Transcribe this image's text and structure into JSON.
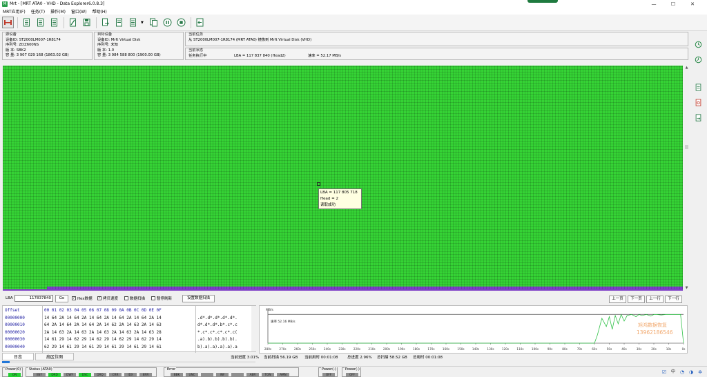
{
  "window": {
    "title": "Mrt - [MRT ATA0 - VHD - Data Explorer6.0.8.3]",
    "app_icon": "mrt-app-icon",
    "controls": {
      "minimize": "—",
      "maximize": "☐",
      "close": "✕"
    }
  },
  "menu": [
    "MRT应用(F)",
    "任务(T)",
    "操作(M)",
    "窗口(W)",
    "帮助(H)"
  ],
  "toolbar": {
    "items": [
      "disk-io-icon",
      "document-icon",
      "document-icon",
      "document-icon",
      "edit-doc-icon",
      "save-icon",
      "document-flow-icon",
      "document-search-icon",
      "list-doc-icon",
      "dropdown-icon",
      "copy-icon",
      "pause-icon",
      "stop-icon",
      "exit-icon"
    ]
  },
  "source_device": {
    "header": "源设备",
    "device_id": "设备ID: ST2000LM007-1R8174",
    "serial": "序列号: ZDZ600NS",
    "version": "版    本: SBK2",
    "capacity": "容    量: 3 907 029 168 (1863.02 GB)"
  },
  "target_device": {
    "header": "目标设备",
    "device_id": "设备ID: Mrft Virtual Disk",
    "serial": "序列号: 未知",
    "version": "版    本: 1.0",
    "capacity": "容    量: 3 984 588 800 (1900.00 GB)"
  },
  "task": {
    "header": "当前任务",
    "description": "从 ST2000LM007-1R8174 (MRT ATA0) 镜像到 Mrft Virtual Disk (VHD)",
    "status_header": "当前状态",
    "status": "任务执行中",
    "lba_status": "LBA = 117 837 840 (Head2)",
    "speed": "速率 = 52.17 MB/s"
  },
  "tooltip": {
    "lba": "LBA = 117 805 718",
    "head": "Head = 2",
    "result": "读取成功"
  },
  "lba_bar": {
    "label": "LBA",
    "value": "117837840",
    "go": "Go",
    "hex_check": "Hex数据",
    "hex_checked": true,
    "copy_speed_check": "拷贝速度",
    "copy_speed_checked": true,
    "scan_check": "数据扫描",
    "scan_checked": false,
    "refresh_check": "暂停刷新",
    "refresh_checked": false,
    "set_scan": "设置数据扫描",
    "prev_page": "上一页",
    "next_page": "下一页",
    "prev_row": "上一行",
    "next_row": "下一行"
  },
  "hex": {
    "header_offset": "Offset",
    "header_bytes": "00 01 02 03 04 05 06 07 08 09 0A 0B 0C 0D 0E 0F",
    "rows": [
      {
        "offset": "00000000",
        "bytes": "14 64 2A 14 64 2A 14 64 2A 14 64 2A 14 64 2A 14",
        "ascii": ".d*.d*.d*.d*.d*."
      },
      {
        "offset": "00000010",
        "bytes": "64 2A 14 64 2A 14 64 2A 14 62 2A 14 63 2A 14 63",
        "ascii": "d*.d*.d*.b*.c*.c"
      },
      {
        "offset": "00000020",
        "bytes": "2A 14 63 2A 14 63 2A 14 63 2A 14 63 2A 14 63 28",
        "ascii": "*.c*.c*.c*.c*.c("
      },
      {
        "offset": "00000030",
        "bytes": "14 61 29 14 62 29 14 62 29 14 62 29 14 62 29 14",
        "ascii": ".a).b).b).b).b)."
      },
      {
        "offset": "00000040",
        "bytes": "62 29 14 61 29 14 61 29 14 61 29 14 61 29 14 61",
        "ascii": "b).a).a).a).a).a"
      }
    ]
  },
  "chart_data": {
    "type": "line",
    "ylabel": "MB/s",
    "legend": "速率 52.16 MB/s",
    "watermark_line1": "旭鸿数据恢复",
    "watermark_line2": "13962186546",
    "x_ticks": [
      "280s",
      "270s",
      "260s",
      "250s",
      "240s",
      "230s",
      "220s",
      "210s",
      "200s",
      "190s",
      "180s",
      "170s",
      "160s",
      "150s",
      "140s",
      "130s",
      "120s",
      "110s",
      "100s",
      "90s",
      "80s",
      "70s",
      "60s",
      "50s",
      "40s",
      "30s",
      "20s",
      "10s",
      "0s"
    ],
    "current_value": 52.16,
    "series": [
      {
        "x": [
          280,
          70,
          60,
          58,
          55,
          52,
          50,
          48,
          46,
          44,
          42,
          40,
          38,
          35,
          32,
          30,
          28,
          25,
          22,
          20,
          18,
          15,
          12,
          10,
          8,
          5,
          2,
          0
        ],
        "y": [
          0,
          0,
          0,
          15,
          45,
          30,
          48,
          25,
          50,
          35,
          52,
          40,
          50,
          52,
          48,
          52,
          50,
          52,
          49,
          52,
          52,
          51,
          52,
          52,
          52,
          52,
          52,
          0
        ]
      }
    ],
    "ylim": [
      0,
      60
    ],
    "line_color": "#33c24a"
  },
  "tabs": {
    "log": "日志",
    "sector_map": "扇区位图"
  },
  "progress_text": {
    "current": "当前进度 3.01%",
    "scanned": "当前扫描 56.19 GB",
    "elapsed": "当前用时 00:01:08",
    "total": "总进度 2.96%",
    "total_scanned": "总扫描 58.52 GB",
    "total_elapsed": "总用时 00:01:08"
  },
  "progress_fraction": 0.0301,
  "led_groups": [
    {
      "title": "Power(0)",
      "leds": [
        {
          "label": "ON",
          "on": true
        }
      ]
    },
    {
      "title": "Status (ATA0)",
      "leds": [
        {
          "label": "BSY",
          "on": false
        },
        {
          "label": "DRD",
          "on": true
        },
        {
          "label": "DWF",
          "on": false
        },
        {
          "label": "DSC",
          "on": true
        },
        {
          "label": "DRQ",
          "on": false
        },
        {
          "label": "CRR",
          "on": false
        },
        {
          "label": "IDX",
          "on": false
        },
        {
          "label": "ERR",
          "on": false
        }
      ]
    },
    {
      "title": "Error",
      "leds": [
        {
          "label": "BBK",
          "on": false
        },
        {
          "label": "UNC",
          "on": false
        },
        {
          "label": "",
          "on": false
        },
        {
          "label": "INF",
          "on": false
        },
        {
          "label": "",
          "on": false
        },
        {
          "label": "ABR",
          "on": false
        },
        {
          "label": "TON",
          "on": false
        },
        {
          "label": "AMN",
          "on": false
        }
      ]
    },
    {
      "title": "Power(-)",
      "leds": [
        {
          "label": "OFF",
          "on": false
        }
      ]
    },
    {
      "title": "Power(-)",
      "leds": [
        {
          "label": "OFF",
          "on": false
        }
      ]
    }
  ],
  "tray": {
    "ime": "中",
    "items": [
      "checkbox-icon",
      "ime-icon",
      "wifi-icon",
      "volume-icon",
      "settings-icon"
    ]
  }
}
